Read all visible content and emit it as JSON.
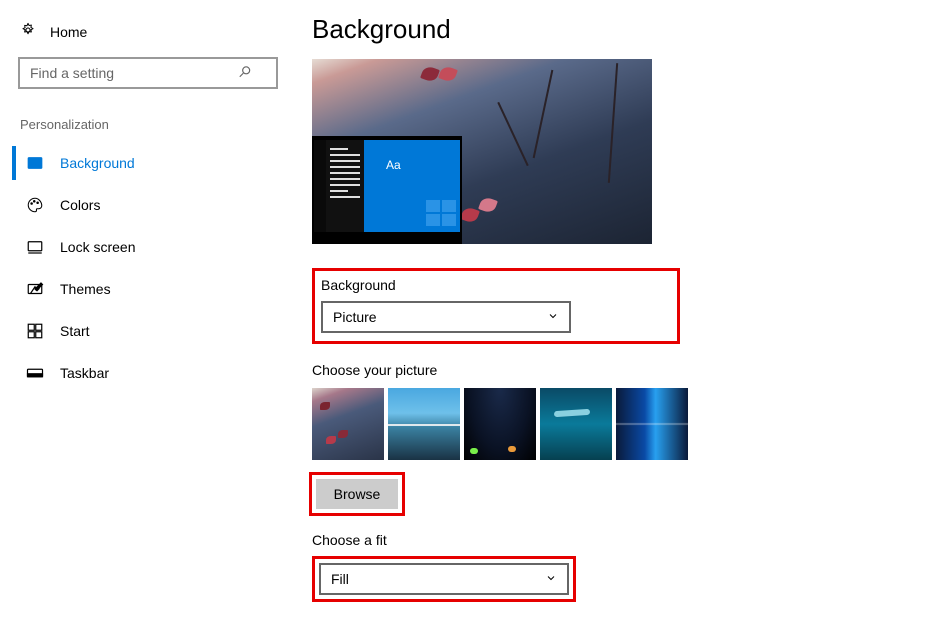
{
  "home": {
    "label": "Home"
  },
  "search": {
    "placeholder": "Find a setting"
  },
  "category": "Personalization",
  "nav": [
    {
      "label": "Background",
      "icon": "picture",
      "active": true
    },
    {
      "label": "Colors",
      "icon": "palette",
      "active": false
    },
    {
      "label": "Lock screen",
      "icon": "lock-screen",
      "active": false
    },
    {
      "label": "Themes",
      "icon": "themes",
      "active": false
    },
    {
      "label": "Start",
      "icon": "start",
      "active": false
    },
    {
      "label": "Taskbar",
      "icon": "taskbar",
      "active": false
    }
  ],
  "page": {
    "title": "Background"
  },
  "preview": {
    "accent_sample": "Aa"
  },
  "background_type": {
    "label": "Background",
    "value": "Picture"
  },
  "choose_picture": {
    "label": "Choose your picture",
    "browse": "Browse"
  },
  "choose_fit": {
    "label": "Choose a fit",
    "value": "Fill"
  }
}
